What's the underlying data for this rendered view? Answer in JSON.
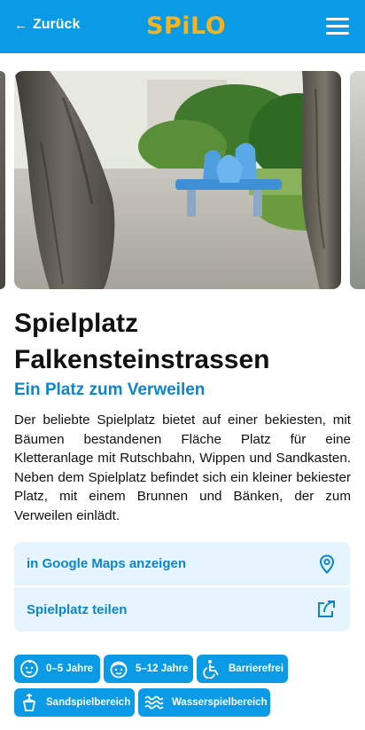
{
  "header": {
    "back_label": "Zurück",
    "logo_text": "SPiLO",
    "back_icon": "arrow-left-icon",
    "menu_icon": "hamburger-menu-icon"
  },
  "playground": {
    "title": "Spielplatz Falkensteinstrassen",
    "subtitle": "Ein Platz zum Verweilen",
    "description": "Der beliebte Spielplatz bietet auf einer bekiesten, mit Bäumen bestandenen Fläche Platz für eine Kletteranlage mit Rutschbahn, Wippen und Sandkasten. Neben dem Spielplatz befindet sich ein kleiner bekiester Platz, mit einem Brunnen und Bänken, der zum Verweilen einlädt."
  },
  "actions": {
    "maps_label": "in Google Maps anzeigen",
    "maps_icon": "location-pin-icon",
    "share_label": "Spielplatz teilen",
    "share_icon": "share-icon"
  },
  "tags": [
    {
      "label": "0–5 Jahre",
      "icon": "baby-face-icon"
    },
    {
      "label": "5–12 Jahre",
      "icon": "child-face-icon"
    },
    {
      "label": "Barrierefrei",
      "icon": "wheelchair-icon"
    },
    {
      "label": "Sandspielbereich",
      "icon": "sand-bucket-icon"
    },
    {
      "label": "Wasserspielbereich",
      "icon": "water-waves-icon"
    }
  ],
  "colors": {
    "brand_blue": "#0b9ae6",
    "accent_yellow": "#f6b41a",
    "link_blue": "#0a86cf",
    "action_bg": "#e6f5fd"
  }
}
